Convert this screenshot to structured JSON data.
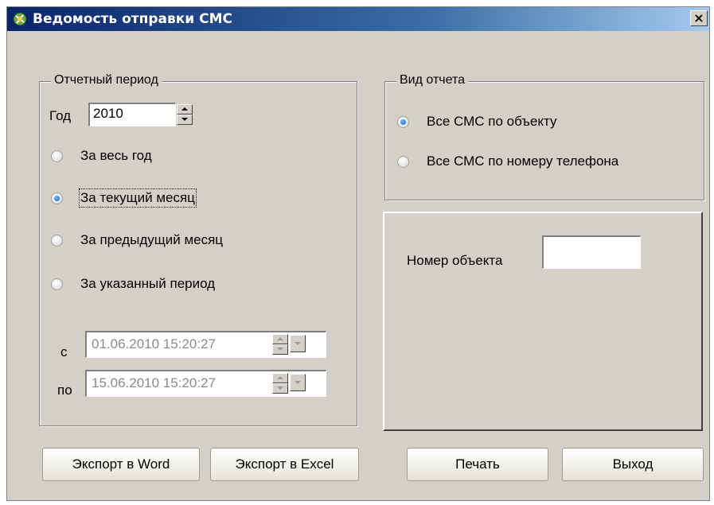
{
  "window": {
    "title": "Ведомость отправки СМС",
    "close_label": "×"
  },
  "period": {
    "legend": "Отчетный период",
    "year_label": "Год",
    "year_value": "2010",
    "options": [
      {
        "label": "За весь год",
        "checked": false
      },
      {
        "label": "За текущий месяц",
        "checked": true
      },
      {
        "label": "За предыдущий месяц",
        "checked": false
      },
      {
        "label": "За указанный период",
        "checked": false
      }
    ],
    "from_label": "с",
    "from_value": "01.06.2010  15:20:27",
    "to_label": "по",
    "to_value": "15.06.2010  15:20:27"
  },
  "report_type": {
    "legend": "Вид отчета",
    "options": [
      {
        "label": "Все СМС по объекту",
        "checked": true
      },
      {
        "label": "Все СМС по номеру телефона",
        "checked": false
      }
    ]
  },
  "object": {
    "label": "Номер объекта",
    "value": ""
  },
  "buttons": {
    "export_word": "Экспорт в Word",
    "export_excel": "Экспорт в Excel",
    "print": "Печать",
    "exit": "Выход"
  }
}
